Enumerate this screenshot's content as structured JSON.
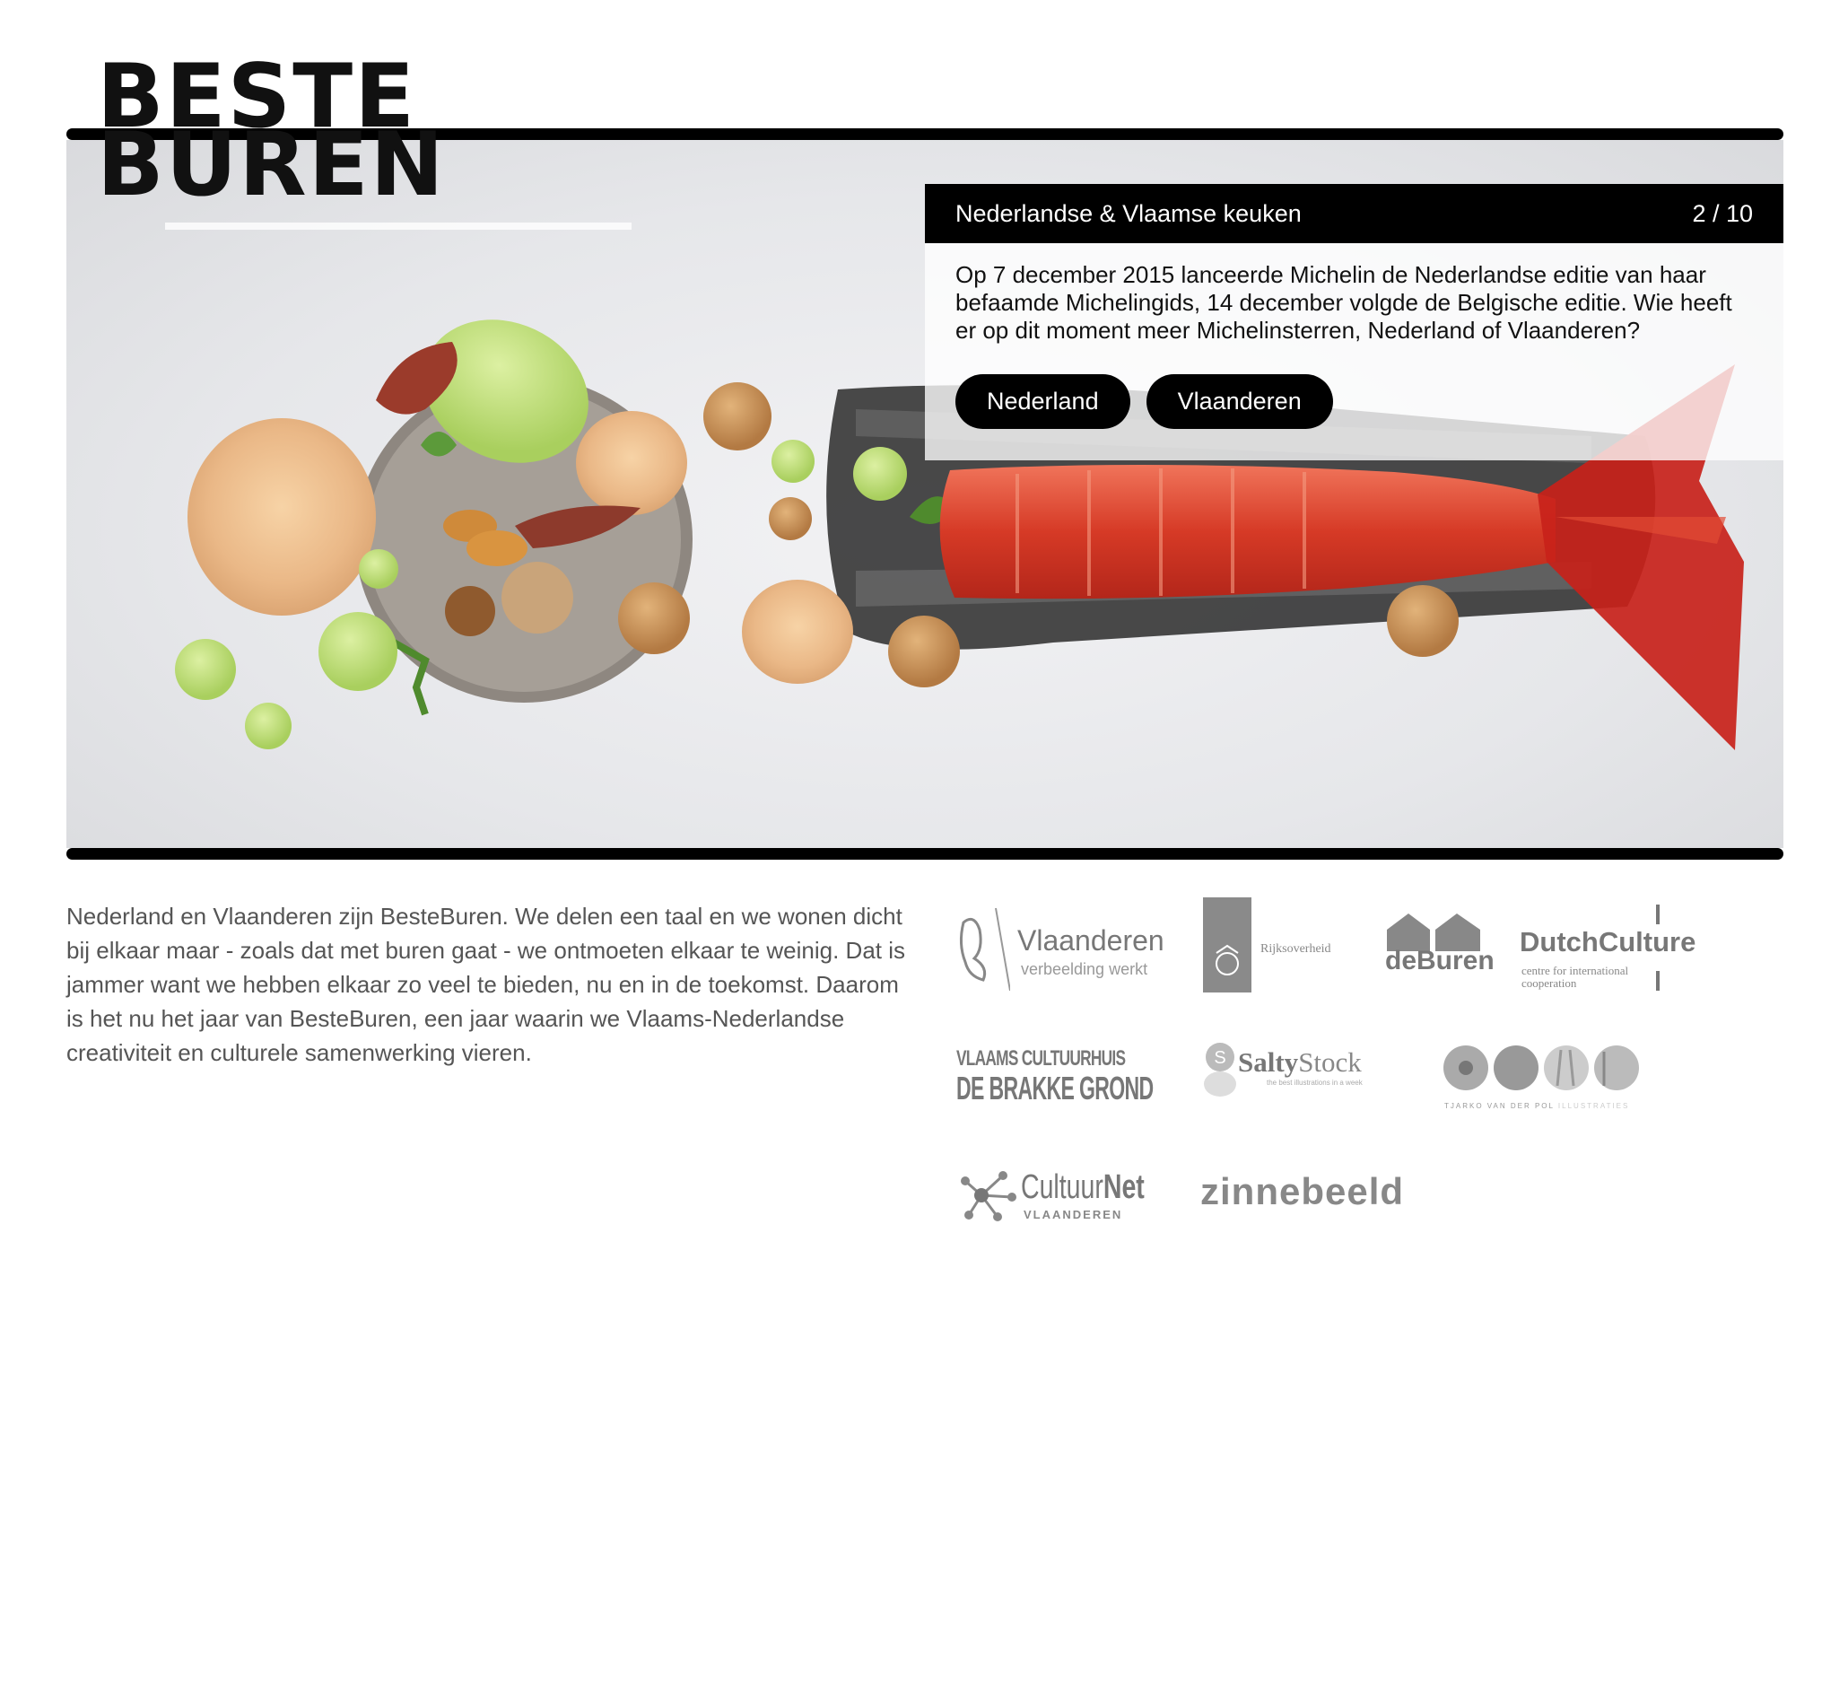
{
  "logo": {
    "line1": "BESTE",
    "line2": "BUREN"
  },
  "quiz": {
    "category": "Nederlandse & Vlaamse keuken",
    "progress": "2 / 10",
    "question": "Op 7 december 2015 lanceerde Michelin de Nederlandse editie van haar befaamde Michelingids, 14 december volgde de Belgische editie. Wie heeft er op dit moment meer Michelinsterren, Nederland of Vlaanderen?",
    "answers": [
      "Nederland",
      "Vlaanderen"
    ]
  },
  "intro": "Nederland en Vlaanderen zijn BesteBuren. We delen een taal en we wonen dicht bij elkaar maar - zoals dat met buren gaat - we ontmoeten elkaar te weinig. Dat is jammer want we hebben elkaar zo veel te bieden, nu en in de toekomst. Daarom is het nu het jaar van BesteBuren, een jaar waarin we Vlaams-Nederlandse creativiteit en culturele samenwerking vieren.",
  "sponsors": {
    "vlaanderen": {
      "name": "Vlaanderen",
      "tagline": "verbeelding werkt"
    },
    "rijksoverheid": {
      "name": "Rijksoverheid"
    },
    "deburen": {
      "name": "deBuren"
    },
    "dutchculture": {
      "name": "DutchCulture",
      "tagline1": "centre for international",
      "tagline2": "cooperation"
    },
    "brakkegrond": {
      "line1": "VLAAMS CULTUURHUIS",
      "line2": "DE BRAKKE GROND"
    },
    "saltystock": {
      "name_bold": "Salty",
      "name_light": "Stock",
      "tagline": "the best illustrations in a week"
    },
    "tjarko": {
      "name": "TJARKO VAN DER POL",
      "suffix": "ILLUSTRATIES"
    },
    "cultuurnet": {
      "name_light": "Cultuur",
      "name_bold": "Net",
      "sub": "VLAANDEREN"
    },
    "zinnebeeld": {
      "name": "zinnebeeld"
    }
  },
  "colors": {
    "accent": "#000000",
    "text_muted": "#555555",
    "logo_gray": "#888888"
  }
}
